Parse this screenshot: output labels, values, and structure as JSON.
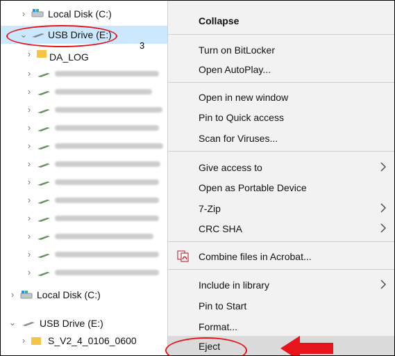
{
  "nav": {
    "items": [
      {
        "label": "Local Disk (C:)"
      },
      {
        "label": "USB Drive (E:)"
      },
      {
        "label": "DA_LOG"
      },
      {
        "label": "Local Disk (C:)"
      },
      {
        "label": "USB Drive (E:)"
      },
      {
        "label": "S_V2_4_0106_0600"
      }
    ],
    "folder_count": "3",
    "blurred_rows": 11
  },
  "menu": {
    "collapse": "Collapse",
    "turn_on_bitlocker": "Turn on BitLocker",
    "open_autoplay": "Open AutoPlay...",
    "open_new_window": "Open in new window",
    "pin_quick_access": "Pin to Quick access",
    "scan_viruses": "Scan for Viruses...",
    "give_access": "Give access to",
    "open_portable": "Open as Portable Device",
    "seven_zip": "7-Zip",
    "crc_sha": "CRC SHA",
    "combine_acrobat": "Combine files in Acrobat...",
    "include_library": "Include in library",
    "pin_start": "Pin to Start",
    "format": "Format...",
    "eject": "Eject"
  },
  "colors": {
    "selection": "#cce8ff",
    "annotation": "#e8141c",
    "menu_bg": "#f2f2f2"
  }
}
